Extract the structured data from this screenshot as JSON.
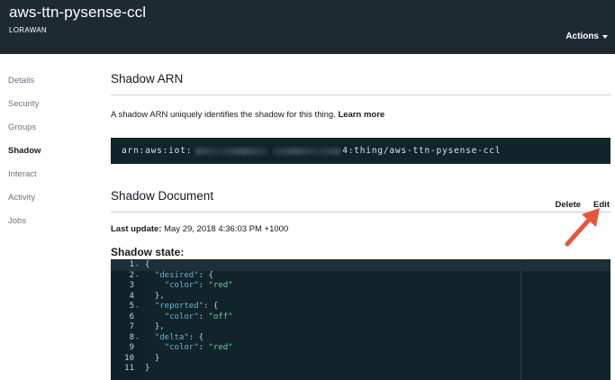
{
  "header": {
    "thing_name": "aws-ttn-pysense-ccl",
    "thing_type": "LORAWAN",
    "actions_label": "Actions"
  },
  "sidebar": {
    "items": [
      {
        "label": "Details"
      },
      {
        "label": "Security"
      },
      {
        "label": "Groups"
      },
      {
        "label": "Shadow",
        "active": true
      },
      {
        "label": "Interact"
      },
      {
        "label": "Activity"
      },
      {
        "label": "Jobs"
      }
    ]
  },
  "arn_section": {
    "title": "Shadow ARN",
    "description": "A shadow ARN uniquely identifies the shadow for this thing.",
    "learn_more": "Learn more",
    "arn_prefix": "arn:aws:iot:",
    "arn_suffix": "4:thing/aws-ttn-pysense-ccl"
  },
  "document_section": {
    "title": "Shadow Document",
    "delete_label": "Delete",
    "edit_label": "Edit",
    "last_update_label": "Last update:",
    "last_update_value": "May 29, 2018 4:36:03 PM +1000",
    "shadow_state_label": "Shadow state:"
  },
  "code": {
    "lines": [
      {
        "n": "1",
        "fold": "-",
        "html": "{"
      },
      {
        "n": "2",
        "fold": "-",
        "key": "\"desired\"",
        "rest": ": {"
      },
      {
        "n": "3",
        "fold": "",
        "key": "\"color\"",
        "mid": ": ",
        "str": "\"red\""
      },
      {
        "n": "4",
        "fold": "",
        "text": "  },"
      },
      {
        "n": "5",
        "fold": "-",
        "key": "\"reported\"",
        "rest": ": {"
      },
      {
        "n": "6",
        "fold": "",
        "key": "\"color\"",
        "mid": ": ",
        "str": "\"off\""
      },
      {
        "n": "7",
        "fold": "",
        "text": "  },"
      },
      {
        "n": "8",
        "fold": "-",
        "key": "\"delta\"",
        "rest": ": {"
      },
      {
        "n": "9",
        "fold": "",
        "key": "\"color\"",
        "mid": ": ",
        "str": "\"red\""
      },
      {
        "n": "10",
        "fold": "",
        "text": "  }"
      },
      {
        "n": "11",
        "fold": "",
        "text": "}"
      }
    ]
  },
  "colors": {
    "header_bg": "#1e2a31",
    "code_bg": "#11232b",
    "json_key": "#6fb3d2",
    "json_string": "#6fcf97",
    "arrow": "#e8553a"
  }
}
